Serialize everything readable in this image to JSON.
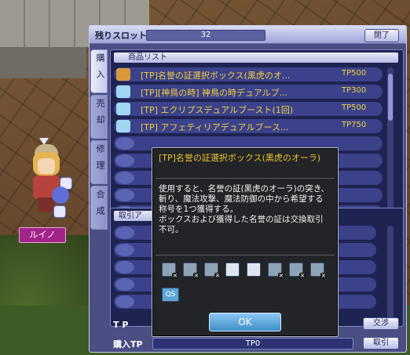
{
  "shop": {
    "slots_label": "残りスロット",
    "slots_value": "32",
    "close_label": "閉了",
    "tabs": [
      {
        "label": "購入",
        "active": true
      },
      {
        "label": "売却",
        "active": false
      },
      {
        "label": "修理",
        "active": false
      },
      {
        "label": "合成",
        "active": false
      }
    ],
    "list_header": "商品リスト",
    "items": [
      {
        "name": "[TP]名誉の証選択ボックス(黒虎のオ...",
        "price": "TP500",
        "icon": "box-icon"
      },
      {
        "name": "[TP][神鳥の時] 神鳥の時デュアルブ...",
        "price": "TP300",
        "icon": "wing-icon"
      },
      {
        "name": "[TP] エクリプスデュアルブースト(1回)",
        "price": "TP500",
        "icon": "wing-icon"
      },
      {
        "name": "[TP] アフェティリアデュアルブース...",
        "price": "TP750",
        "icon": "wing-icon"
      }
    ],
    "trade_header": "取引ア",
    "tp_label": "T P",
    "buy_tp_label": "購入TP",
    "buy_tp_value": "TP0",
    "exchange_label": "交渉",
    "trade_label": "取引"
  },
  "tooltip": {
    "title": "[TP]名誉の証選択ボックス(黒虎のオーラ)",
    "description": "使用すると、名誉の証(黒虎のオーラ)の突き、斬り、魔法攻撃、魔法防御の中から希望する称号を1つ獲得する。\nボックスおよび獲得した名誉の証は交換取引不可。",
    "tags": [
      "drop-icon",
      "trade-icon",
      "sell-icon",
      "bank-icon",
      "shop-icon",
      "mail-icon",
      "guild-icon",
      "storage-icon"
    ],
    "qs_label": "QS",
    "ok_label": "OK"
  },
  "character": {
    "name": "ルイノ"
  }
}
